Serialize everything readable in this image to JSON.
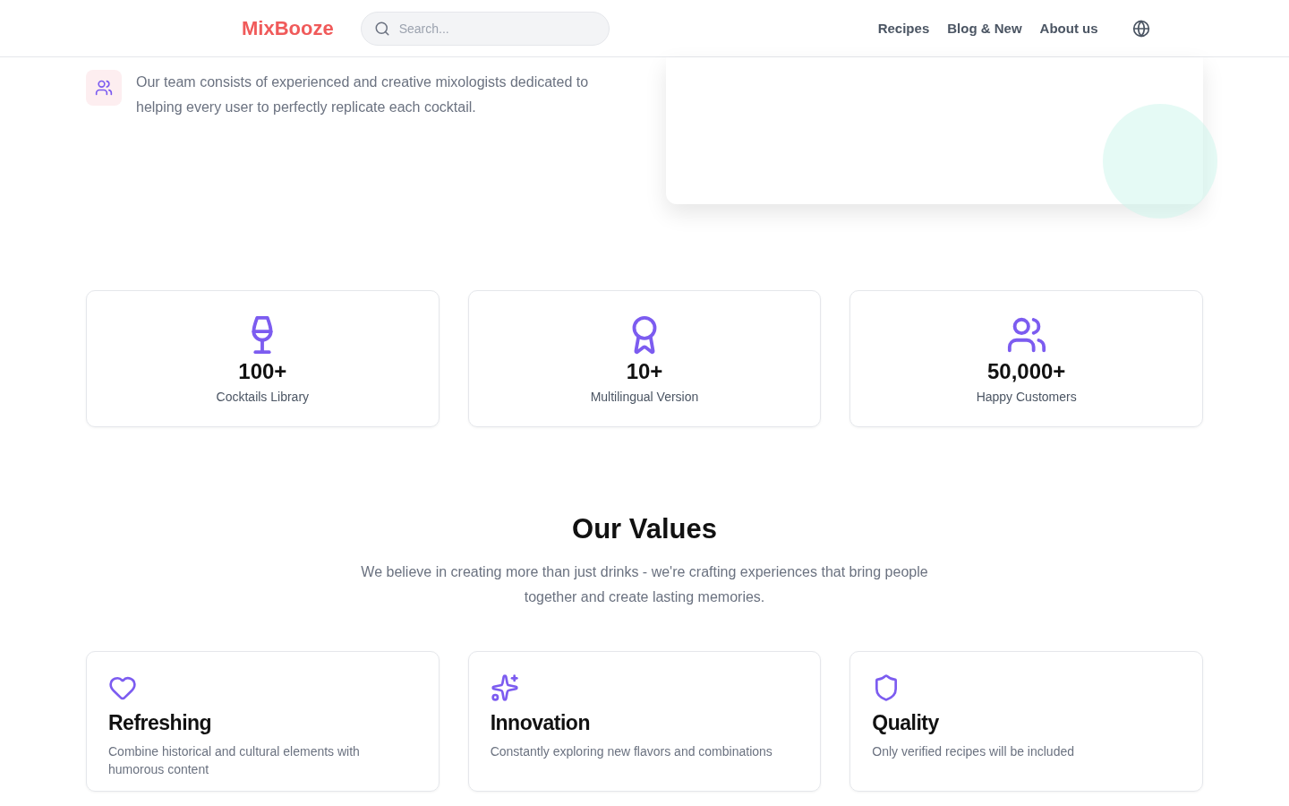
{
  "header": {
    "logo": "MixBooze",
    "search": {
      "placeholder": "Search..."
    },
    "nav": [
      {
        "label": "Recipes"
      },
      {
        "label": "Blog & New"
      },
      {
        "label": "About us"
      }
    ]
  },
  "feature": {
    "description": "Our team consists of experienced and creative mixologists dedicated to helping every user to perfectly replicate each cocktail."
  },
  "stats": [
    {
      "kind": "wine",
      "value": "100+",
      "label": "Cocktails Library"
    },
    {
      "kind": "award",
      "value": "10+",
      "label": "Multilingual Version"
    },
    {
      "kind": "users",
      "value": "50,000+",
      "label": "Happy Customers"
    }
  ],
  "values": {
    "title": "Our Values",
    "subtitle": "We believe in creating more than just drinks - we're crafting experiences that bring people together and create lasting memories.",
    "cards": [
      {
        "kind": "heart",
        "title": "Refreshing",
        "text": "Combine historical and cultural elements with humorous content"
      },
      {
        "kind": "sparkles",
        "title": "Innovation",
        "text": "Constantly exploring new flavors and combinations"
      },
      {
        "kind": "shield",
        "title": "Quality",
        "text": "Only verified recipes will be included"
      }
    ]
  }
}
